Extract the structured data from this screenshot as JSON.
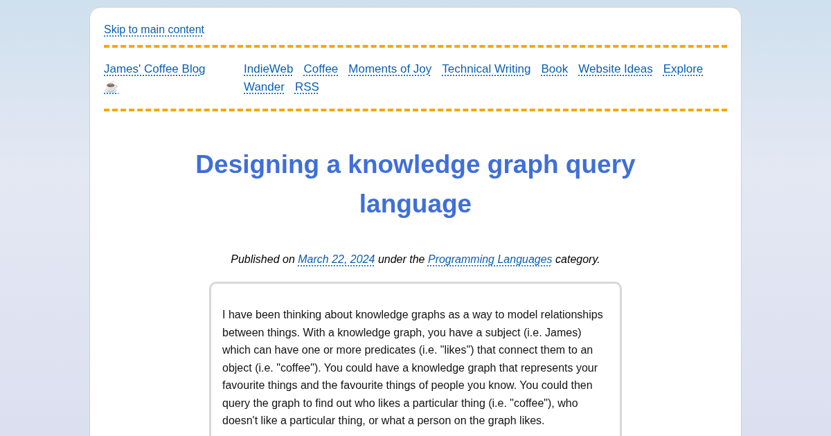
{
  "skip_link": "Skip to main content",
  "site_title": "James' Coffee Blog ☕",
  "nav": [
    "IndieWeb",
    "Coffee",
    "Moments of Joy",
    "Technical Writing",
    "Book",
    "Website Ideas",
    "Explore",
    "Wander",
    "RSS"
  ],
  "article": {
    "title": "Designing a knowledge graph query language",
    "meta": {
      "prefix": "Published on",
      "date": "March 22, 2024",
      "middle": "under the",
      "category": "Programming Languages",
      "suffix": "category."
    },
    "paragraph": "I have been thinking about knowledge graphs as a way to model relationships between things. With a knowledge graph, you have a subject (i.e. James) which can have one or more predicates (i.e. \"likes\") that connect them to an object (i.e. \"coffee\"). You could have a knowledge graph that represents your favourite things and the favourite things of people you know. You could then query the graph to find out who likes a particular thing (i.e. \"coffee\"), who doesn't like a particular thing, or what a person on the graph likes."
  }
}
